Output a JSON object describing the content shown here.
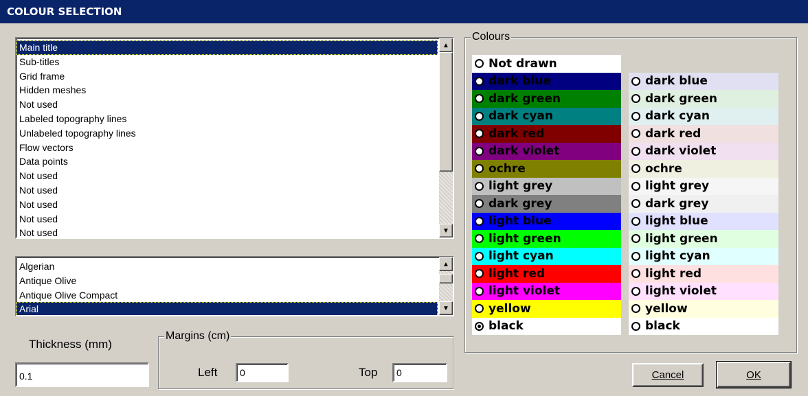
{
  "window": {
    "title": "COLOUR SELECTION"
  },
  "elements_list": {
    "items": [
      "Main title",
      "Sub-titles",
      "Grid frame",
      "Hidden meshes",
      "Not used",
      "Labeled topography lines",
      "Unlabeled topography lines",
      "Flow vectors",
      "Data points",
      "Not used",
      "Not used",
      "Not used",
      "Not used",
      "Not used"
    ],
    "selected_index": 0
  },
  "font_list": {
    "items": [
      "Algerian",
      "Antique Olive",
      "Antique Olive Compact",
      "Arial"
    ],
    "selected_index": 3
  },
  "thickness": {
    "label": "Thickness (mm)",
    "value": "0.1"
  },
  "margins": {
    "group_label": "Margins (cm)",
    "left_label": "Left",
    "left_value": "0",
    "top_label": "Top",
    "top_value": "0"
  },
  "colours": {
    "group_label": "Colours",
    "not_drawn_label": "Not drawn",
    "dark_column": [
      {
        "label": "dark blue",
        "bg": "#000080",
        "fg": "#000000"
      },
      {
        "label": "dark green",
        "bg": "#008000",
        "fg": "#000000"
      },
      {
        "label": "dark cyan",
        "bg": "#008080",
        "fg": "#000000"
      },
      {
        "label": "dark red",
        "bg": "#800000",
        "fg": "#000000"
      },
      {
        "label": "dark violet",
        "bg": "#800080",
        "fg": "#000000"
      },
      {
        "label": "ochre",
        "bg": "#808000",
        "fg": "#000000"
      },
      {
        "label": "light grey",
        "bg": "#c0c0c0",
        "fg": "#000000"
      },
      {
        "label": "dark grey",
        "bg": "#808080",
        "fg": "#000000"
      },
      {
        "label": "light blue",
        "bg": "#0000ff",
        "fg": "#000000"
      },
      {
        "label": "light green",
        "bg": "#00ff00",
        "fg": "#000000"
      },
      {
        "label": "light cyan",
        "bg": "#00ffff",
        "fg": "#000000"
      },
      {
        "label": "light red",
        "bg": "#ff0000",
        "fg": "#000000"
      },
      {
        "label": "light violet",
        "bg": "#ff00ff",
        "fg": "#000000"
      },
      {
        "label": "yellow",
        "bg": "#ffff00",
        "fg": "#000000"
      },
      {
        "label": "black",
        "bg": "#ffffff",
        "fg": "#000000",
        "checked": true
      }
    ],
    "light_column": [
      {
        "label": "dark blue",
        "bg": "#e0e0f2"
      },
      {
        "label": "dark green",
        "bg": "#e0f0e0"
      },
      {
        "label": "dark cyan",
        "bg": "#e0f0f0"
      },
      {
        "label": "dark red",
        "bg": "#f0e0e0"
      },
      {
        "label": "dark violet",
        "bg": "#f0e0f0"
      },
      {
        "label": "ochre",
        "bg": "#f0f0e0"
      },
      {
        "label": "light grey",
        "bg": "#f6f6f6"
      },
      {
        "label": "dark grey",
        "bg": "#f0f0f0"
      },
      {
        "label": "light blue",
        "bg": "#e0e0ff"
      },
      {
        "label": "light green",
        "bg": "#e0ffe0"
      },
      {
        "label": "light cyan",
        "bg": "#e0ffff"
      },
      {
        "label": "light red",
        "bg": "#ffe0e0"
      },
      {
        "label": "light violet",
        "bg": "#ffe0ff"
      },
      {
        "label": "yellow",
        "bg": "#ffffe0"
      },
      {
        "label": "black",
        "bg": "#ffffff"
      }
    ]
  },
  "buttons": {
    "cancel": "Cancel",
    "ok": "OK"
  }
}
